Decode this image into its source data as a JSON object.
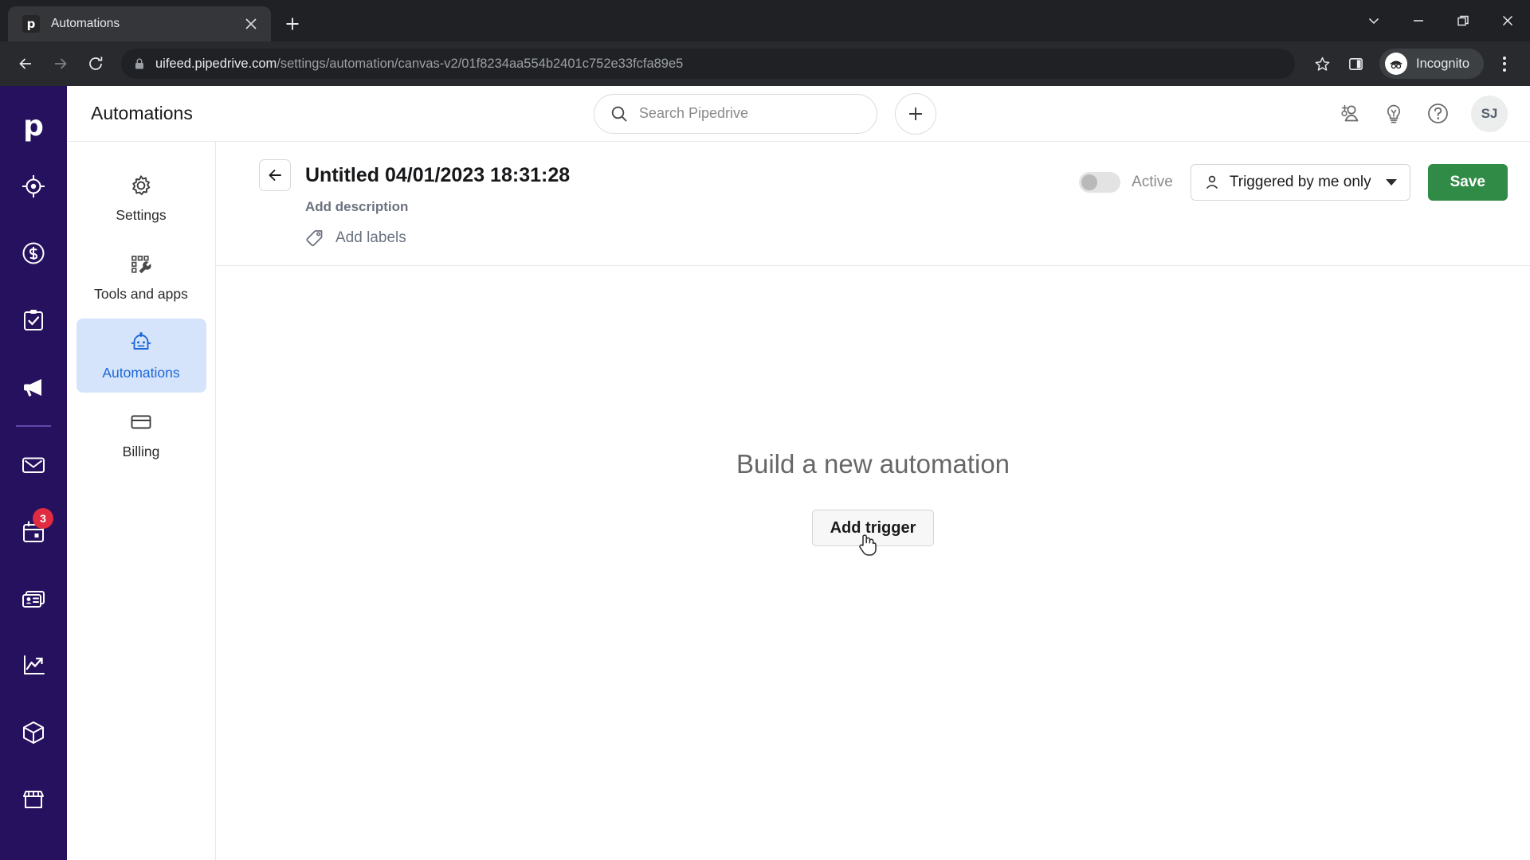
{
  "browser": {
    "tab": {
      "title": "Automations",
      "favicon_letter": "p",
      "favicon_name": "pipedrive-favicon",
      "close_icon": "close-icon"
    },
    "new_tab_label": "+",
    "window_controls": [
      {
        "name": "tab-search-button",
        "icon": "chevron-down-icon"
      },
      {
        "name": "minimize-button",
        "icon": "minimize-icon"
      },
      {
        "name": "maximize-button",
        "icon": "maximize-icon"
      },
      {
        "name": "close-window-button",
        "icon": "close-icon"
      }
    ],
    "nav": {
      "back": "back-arrow-icon",
      "forward": "forward-arrow-icon",
      "reload": "reload-icon"
    },
    "omnibox": {
      "lock_icon": "lock-icon",
      "domain": "uifeed.pipedrive.com",
      "path": "/settings/automation/canvas-v2/01f8234aa554b2401c752e33fcfa89e5",
      "full_url": "uifeed.pipedrive.com/settings/automation/canvas-v2/01f8234aa554b2401c752e33fcfa89e5"
    },
    "toolbar_right": {
      "bookmark_icon": "star-icon",
      "side_panel_icon": "side-panel-icon",
      "incognito_label": "Incognito",
      "incognito_icon": "incognito-spy-icon",
      "menu_icon": "three-dot-menu-icon"
    }
  },
  "nav_rail": {
    "logo": "p",
    "items": [
      {
        "name": "leads",
        "icon": "target-icon"
      },
      {
        "name": "deals",
        "icon": "dollar-circle-icon"
      },
      {
        "name": "activities",
        "icon": "clipboard-check-icon"
      },
      {
        "name": "campaigns",
        "icon": "megaphone-icon"
      },
      {
        "name": "mail",
        "icon": "envelope-icon"
      },
      {
        "name": "calendar",
        "icon": "calendar-icon",
        "badge": "3"
      },
      {
        "name": "contacts",
        "icon": "contact-card-icon"
      },
      {
        "name": "insights",
        "icon": "line-chart-icon"
      },
      {
        "name": "products",
        "icon": "box-icon"
      },
      {
        "name": "marketplace",
        "icon": "storefront-icon"
      }
    ]
  },
  "app_header": {
    "title": "Automations",
    "search": {
      "placeholder": "Search Pipedrive",
      "icon": "search-icon"
    },
    "add_button": "+",
    "icons": [
      {
        "name": "invite-user",
        "icon": "add-person-icon"
      },
      {
        "name": "whats-new",
        "icon": "lightbulb-icon"
      },
      {
        "name": "help",
        "icon": "question-mark-icon"
      }
    ],
    "avatar_initials": "SJ"
  },
  "settings_nav": {
    "items": [
      {
        "label": "Settings",
        "icon": "gear-icon",
        "active": false
      },
      {
        "label": "Tools and apps",
        "icon": "grid-wrench-icon",
        "active": false
      },
      {
        "label": "Automations",
        "icon": "robot-icon",
        "active": true
      },
      {
        "label": "Billing",
        "icon": "credit-card-icon",
        "active": false
      }
    ]
  },
  "automation": {
    "back_icon": "back-arrow-icon",
    "title": "Untitled 04/01/2023 18:31:28",
    "description_placeholder": "Add description",
    "labels_placeholder": "Add labels",
    "labels_icon": "tag-icon",
    "toggle": {
      "label": "Active",
      "state": "off"
    },
    "visibility": {
      "value": "Triggered by me only",
      "icon": "person-icon",
      "caret": "chevron-down-icon"
    },
    "save_label": "Save"
  },
  "canvas": {
    "heading": "Build a new automation",
    "trigger_button": "Add trigger",
    "cursor": "pointing-hand-cursor"
  },
  "colors": {
    "nav_rail": "#26115e",
    "accent_blue": "#1c68d9",
    "active_bg": "#d6e4fb",
    "save_green": "#2f8b45",
    "badge_red": "#e02b41",
    "browser_tabstrip": "#202124",
    "browser_toolbar": "#292a2d"
  }
}
